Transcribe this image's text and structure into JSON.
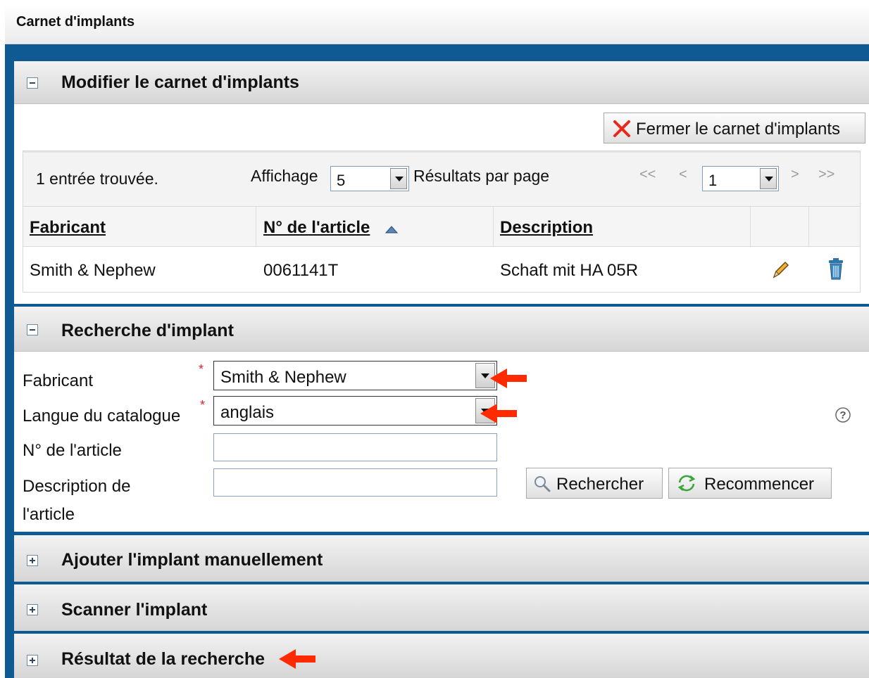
{
  "window": {
    "title": "Carnet d'implants"
  },
  "section_edit": {
    "title": "Modifier le carnet d'implants",
    "close_label": "Fermer le carnet d'implants",
    "pager": {
      "count_text": "1 entrée trouvée.",
      "display_label": "Affichage",
      "per_page_value": "5",
      "per_page_label": "Résultats par page",
      "first": "<<",
      "prev": "<",
      "page_value": "1",
      "next": ">",
      "last": ">>"
    },
    "columns": [
      "Fabricant",
      "N° de l'article",
      "Description"
    ],
    "rows": [
      {
        "manufacturer": "Smith & Nephew",
        "article_no": "0061141T",
        "description": "Schaft mit HA 05R"
      }
    ]
  },
  "section_search": {
    "title": "Recherche d'implant",
    "fields": {
      "manufacturer_label": "Fabricant",
      "manufacturer_value": "Smith & Nephew",
      "language_label": "Langue du catalogue",
      "language_value": "anglais",
      "article_no_label": "N° de l'article",
      "article_no_value": "",
      "description_label_1": "Description de",
      "description_label_2": "l'article",
      "description_value": ""
    },
    "required_mark": "*",
    "search_label": "Rechercher",
    "reset_label": "Recommencer",
    "help_glyph": "?"
  },
  "section_add": {
    "title": "Ajouter l'implant manuellement"
  },
  "section_scan": {
    "title": "Scanner l'implant"
  },
  "section_results": {
    "title": "Résultat de la recherche"
  },
  "colors": {
    "frame": "#0f5a92",
    "close_x": "#e8281e",
    "annotation_arrow": "#ff2a00",
    "trash": "#2f74a8"
  }
}
